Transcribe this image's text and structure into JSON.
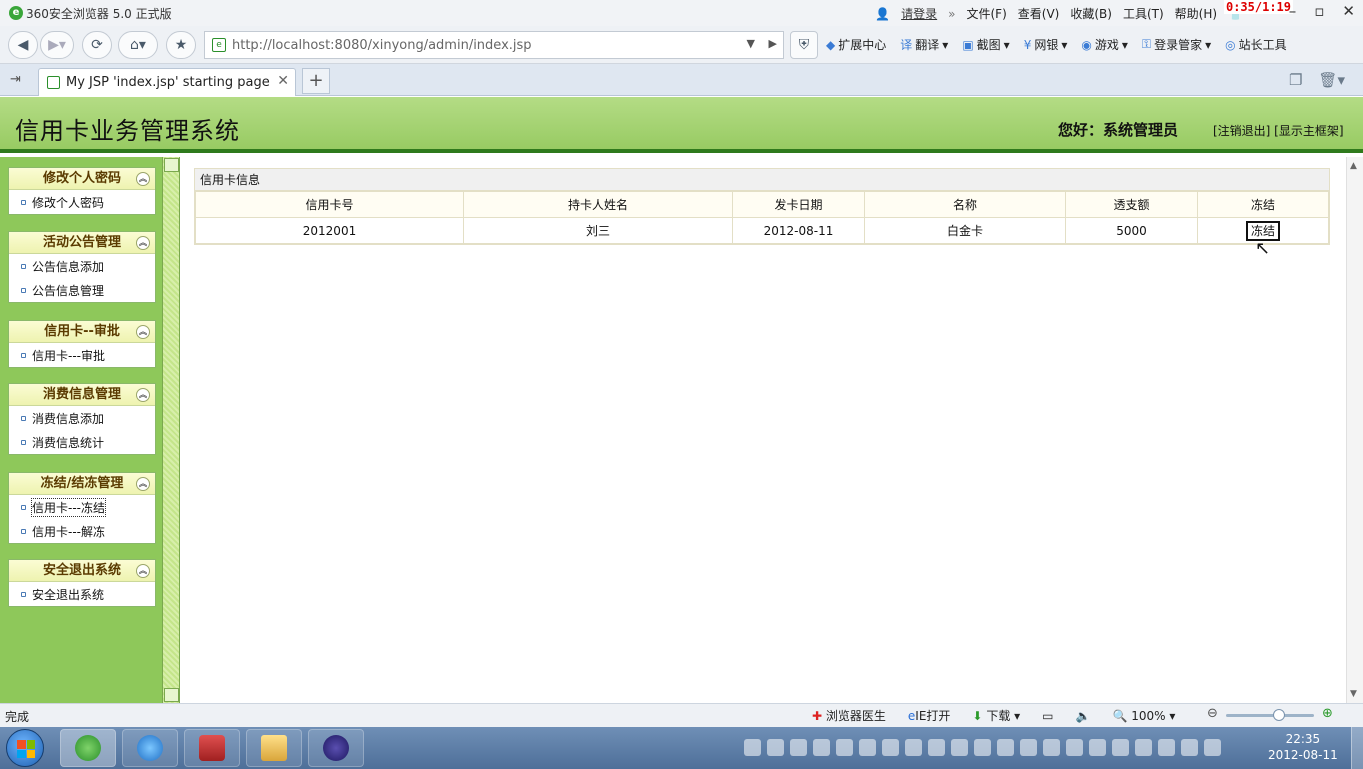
{
  "browser": {
    "title": "360安全浏览器 5.0 正式版",
    "menu": {
      "login": "请登录",
      "arrows": "»",
      "file": "文件(F)",
      "view": "查看(V)",
      "favorites": "收藏(B)",
      "tools": "工具(T)",
      "help": "帮助(H)"
    },
    "timer": "0:35/1:19",
    "url": "http://localhost:8080/xinyong/admin/index.jsp",
    "toolbar": [
      "扩展中心",
      "翻译",
      "截图",
      "网银",
      "游戏",
      "登录管家",
      "站长工具"
    ],
    "tab_title": "My JSP 'index.jsp' starting page",
    "status": "完成",
    "status_items": {
      "doctor": "浏览器医生",
      "ie": "IE打开",
      "download": "下载",
      "zoom": "100%"
    },
    "zoom_level": 1.0
  },
  "header": {
    "system_title": "信用卡业务管理系统",
    "greeting": "您好：系统管理员",
    "links": "[注销退出] [显示主框架]"
  },
  "sidebar": {
    "groups": [
      {
        "title": "修改个人密码",
        "items": [
          "修改个人密码"
        ]
      },
      {
        "title": "活动公告管理",
        "items": [
          "公告信息添加",
          "公告信息管理"
        ]
      },
      {
        "title": "信用卡--审批",
        "items": [
          "信用卡---审批"
        ]
      },
      {
        "title": "消费信息管理",
        "items": [
          "消费信息添加",
          "消费信息统计"
        ]
      },
      {
        "title": "冻结/结冻管理",
        "items": [
          "信用卡---冻结",
          "信用卡---解冻"
        ]
      },
      {
        "title": "安全退出系统",
        "items": [
          "安全退出系统"
        ]
      }
    ]
  },
  "table": {
    "caption": "信用卡信息",
    "columns": [
      "信用卡号",
      "持卡人姓名",
      "发卡日期",
      "名称",
      "透支额",
      "冻结"
    ],
    "rows": [
      {
        "card_no": "2012001",
        "holder": "刘三",
        "issue_date": "2012-08-11",
        "name": "白金卡",
        "overdraft": "5000",
        "action": "冻结"
      }
    ]
  },
  "taskbar": {
    "time": "22:35",
    "date": "2012-08-11"
  },
  "colors": {
    "header_green": "#98cb63",
    "header_rule": "#2f7a1c",
    "sidebar_green": "#8ec85a",
    "menu_title": "#5a3a00"
  }
}
